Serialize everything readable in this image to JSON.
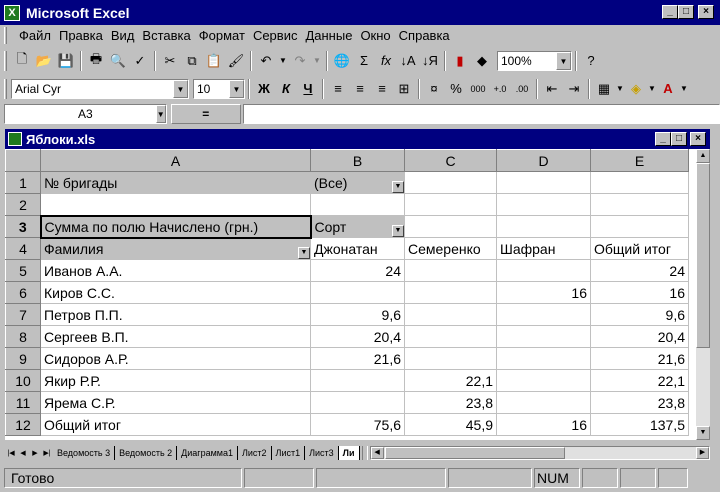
{
  "app": {
    "title": "Microsoft Excel",
    "icon": "excel-icon"
  },
  "menu": [
    "Файл",
    "Правка",
    "Вид",
    "Вставка",
    "Формат",
    "Сервис",
    "Данные",
    "Окно",
    "Справка"
  ],
  "standard_toolbar": {
    "zoom": "100%"
  },
  "format_toolbar": {
    "font": "Arial Cyr",
    "size": "10",
    "bold": "Ж",
    "italic": "К",
    "underline": "Ч"
  },
  "formula_bar": {
    "name_box": "A3",
    "equals": "=",
    "value": ""
  },
  "workbook": {
    "title": "Яблоки.xls"
  },
  "columns": [
    "A",
    "B",
    "C",
    "D",
    "E"
  ],
  "rows": [
    {
      "n": "1",
      "a": "№ бригады",
      "b": "(Все)",
      "c": "",
      "d": "",
      "e": ""
    },
    {
      "n": "2",
      "a": "",
      "b": "",
      "c": "",
      "d": "",
      "e": ""
    },
    {
      "n": "3",
      "a": "Сумма по полю Начислено (грн.)",
      "b": "Сорт",
      "c": "",
      "d": "",
      "e": ""
    },
    {
      "n": "4",
      "a": "Фамилия",
      "b": "Джонатан",
      "c": "Семеренко",
      "d": "Шафран",
      "e": "Общий итог"
    },
    {
      "n": "5",
      "a": "Иванов А.А.",
      "b": "24",
      "c": "",
      "d": "",
      "e": "24"
    },
    {
      "n": "6",
      "a": "Киров С.С.",
      "b": "",
      "c": "",
      "d": "16",
      "e": "16"
    },
    {
      "n": "7",
      "a": "Петров П.П.",
      "b": "9,6",
      "c": "",
      "d": "",
      "e": "9,6"
    },
    {
      "n": "8",
      "a": "Сергеев В.П.",
      "b": "20,4",
      "c": "",
      "d": "",
      "e": "20,4"
    },
    {
      "n": "9",
      "a": "Сидоров А.Р.",
      "b": "21,6",
      "c": "",
      "d": "",
      "e": "21,6"
    },
    {
      "n": "10",
      "a": "Якир Р.Р.",
      "b": "",
      "c": "22,1",
      "d": "",
      "e": "22,1"
    },
    {
      "n": "11",
      "a": "Ярема С.Р.",
      "b": "",
      "c": "23,8",
      "d": "",
      "e": "23,8"
    },
    {
      "n": "12",
      "a": "Общий итог",
      "b": "75,6",
      "c": "45,9",
      "d": "16",
      "e": "137,5"
    }
  ],
  "sheet_tabs": [
    "Ведомость 3",
    "Ведомость 2",
    "Диаграмма1",
    "Лист2",
    "Лист1",
    "Лист3",
    "Ли"
  ],
  "status": {
    "ready": "Готово",
    "num": "NUM"
  }
}
